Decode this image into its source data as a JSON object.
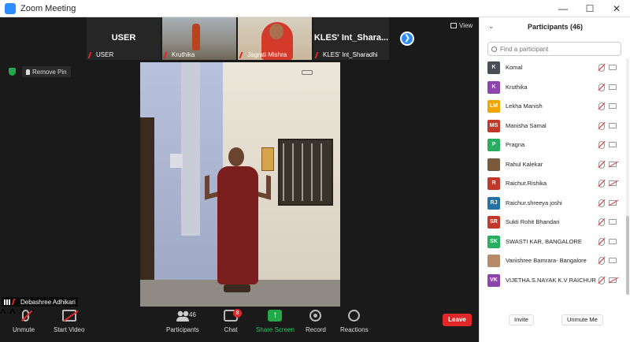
{
  "window": {
    "title": "Zoom Meeting",
    "controls": [
      "—",
      "☐",
      "✕"
    ]
  },
  "thumbnails": [
    {
      "name": "USER",
      "big_label": "USER"
    },
    {
      "name": "Kruthika",
      "big_label": ""
    },
    {
      "name": "Jagrati Mishra",
      "big_label": ""
    },
    {
      "name": "KLES' Int_Sharadhi",
      "big_label": "KLES' Int_Shara..."
    }
  ],
  "view_label": "View",
  "remove_pin_label": "Remove Pin",
  "active_speaker": "Debashree Adhikari",
  "toolbar": {
    "unmute": "Unmute",
    "start_video": "Start Video",
    "participants": "Participants",
    "participants_count": "46",
    "chat": "Chat",
    "chat_badge": "8",
    "share_screen": "Share Screen",
    "record": "Record",
    "reactions": "Reactions",
    "leave": "Leave"
  },
  "panel": {
    "title": "Participants (46)",
    "search_placeholder": "Find a participant",
    "invite": "Invite",
    "unmute_me": "Unmute Me",
    "participants": [
      {
        "initials": "K",
        "name": "Komal",
        "color": "#4a4f57",
        "video_off": false
      },
      {
        "initials": "K",
        "name": "Kruthika",
        "color": "#8e44ad",
        "video_off": false
      },
      {
        "initials": "LM",
        "name": "Lekha Manish",
        "color": "#f0a500",
        "video_off": false
      },
      {
        "initials": "MS",
        "name": "Manisha Samal",
        "color": "#c0392b",
        "video_off": false
      },
      {
        "initials": "P",
        "name": "Pragna",
        "color": "#27ae60",
        "video_off": false
      },
      {
        "initials": "",
        "name": "Rahul Kalekar",
        "color": "#7a5a3a",
        "video_off": true
      },
      {
        "initials": "R",
        "name": "Raichur.Rishika",
        "color": "#c0392b",
        "video_off": true
      },
      {
        "initials": "RJ",
        "name": "Raichur.shreeya joshi",
        "color": "#2471a3",
        "video_off": true
      },
      {
        "initials": "SR",
        "name": "Sukti Rohit Bhandari",
        "color": "#c0392b",
        "video_off": false
      },
      {
        "initials": "SK",
        "name": "SWASTI KAR,  BANGALORE",
        "color": "#27ae60",
        "video_off": false
      },
      {
        "initials": "",
        "name": "Vanishree Bamrara- Bangalore",
        "color": "#b58b6a",
        "video_off": false
      },
      {
        "initials": "VK",
        "name": "VIJETHA.S.NAYAK K.V RAICHUR",
        "color": "#8e44ad",
        "video_off": true
      }
    ]
  }
}
